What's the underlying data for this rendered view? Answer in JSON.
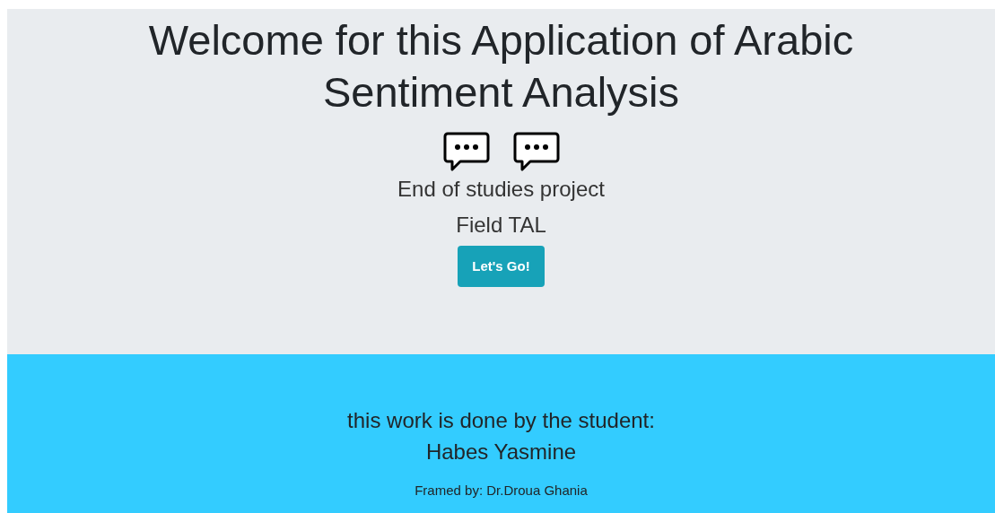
{
  "hero": {
    "title": "Welcome for this Application of Arabic Sentiment Analysis",
    "subtitle": "End of studies project",
    "field": "Field TAL",
    "button": "Let's Go!"
  },
  "footer": {
    "intro": "this work is done by the student:",
    "student": "Habes Yasmine",
    "supervisor": "Framed by: Dr.Droua Ghania"
  }
}
